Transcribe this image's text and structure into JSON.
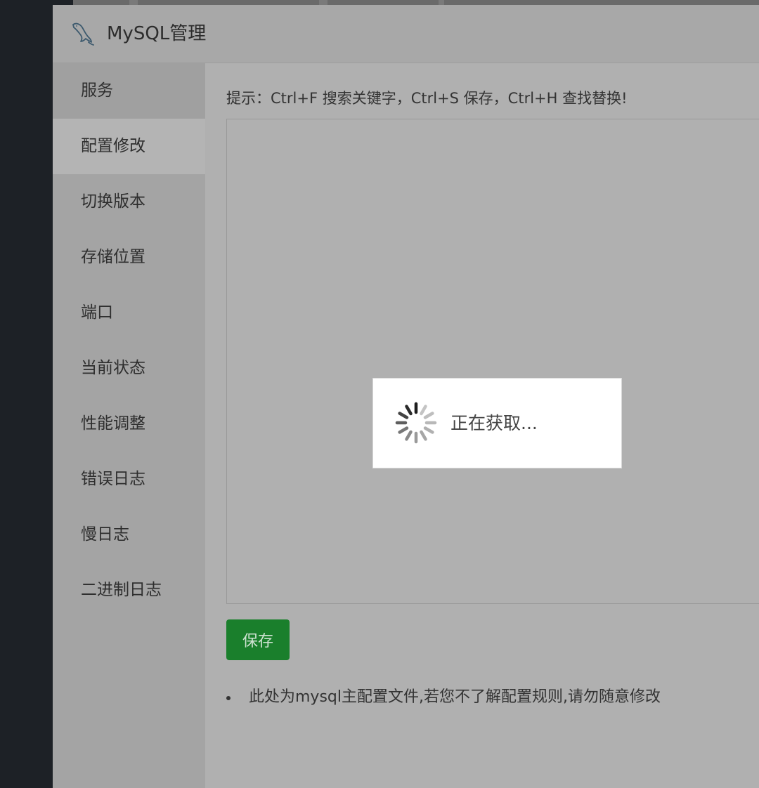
{
  "window": {
    "title": "MySQL管理",
    "logo_icon": "mysql-dolphin-icon"
  },
  "sidebar": {
    "items": [
      {
        "label": "服务"
      },
      {
        "label": "配置修改",
        "active": true
      },
      {
        "label": "切换版本"
      },
      {
        "label": "存储位置"
      },
      {
        "label": "端口"
      },
      {
        "label": "当前状态"
      },
      {
        "label": "性能调整"
      },
      {
        "label": "错误日志"
      },
      {
        "label": "慢日志"
      },
      {
        "label": "二进制日志"
      }
    ]
  },
  "main": {
    "tip": "提示：Ctrl+F 搜索关键字，Ctrl+S 保存，Ctrl+H 查找替换!",
    "editor_content": "",
    "save_label": "保存",
    "notes": [
      "此处为mysql主配置文件,若您不了解配置规则,请勿随意修改"
    ]
  },
  "loading": {
    "text": "正在获取...",
    "icon": "spinner-icon"
  },
  "colors": {
    "save_button": "#1a7f2c",
    "overlay_background": "#1d2126",
    "modal_background": "#aeaeae"
  }
}
